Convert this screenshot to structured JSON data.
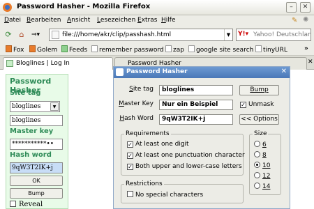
{
  "window": {
    "title": "Password Hasher - Mozilla Firefox"
  },
  "menu": [
    "Datei",
    "Bearbeiten",
    "Ansicht",
    "Lesezeichen",
    "Extras",
    "Hilfe"
  ],
  "nav": {
    "url": "file:///home/akr/clip/passhash.html",
    "search_placeholder": "Yahoo! Deutschland"
  },
  "bookmarks": [
    "Fox",
    "Golem",
    "Feeds",
    "remember password",
    "zap",
    "google site search",
    "tinyURL"
  ],
  "tabs": {
    "active": "Bloglines | Log In",
    "second": "Password Hasher"
  },
  "bookmarklet": {
    "title": "Password Hasher",
    "site_tag_label": "Site tag",
    "site_tag_value": "bloglines",
    "site_tag_text": "bloglines",
    "master_key_label": "Master key",
    "master_key_value": "***********••",
    "hash_word_label": "Hash word",
    "hash_word_value": "9qW3T2IK+j",
    "ok_label": "OK",
    "bump_label": "Bump",
    "reveal_label": "Reveal"
  },
  "dialog": {
    "title": "Password Hasher",
    "site_tag_label": "Site tag",
    "site_tag_value": "bloglines",
    "master_key_label": "Master Key",
    "master_key_value": "Nur ein Beispiel",
    "hash_word_label": "Hash Word",
    "hash_word_value": "9qW3T2IK+j",
    "bump_label": "Bump",
    "unmask_label": "Unmask",
    "options_label": "<< Options",
    "requirements_title": "Requirements",
    "req_digit": "At least one digit",
    "req_punct": "At least one punctuation character",
    "req_case": "Both upper and lower-case letters",
    "restrictions_title": "Restrictions",
    "restr_special": "No special characters",
    "size_title": "Size",
    "sizes": [
      "6",
      "8",
      "10",
      "12",
      "14"
    ],
    "selected_size": "10"
  }
}
